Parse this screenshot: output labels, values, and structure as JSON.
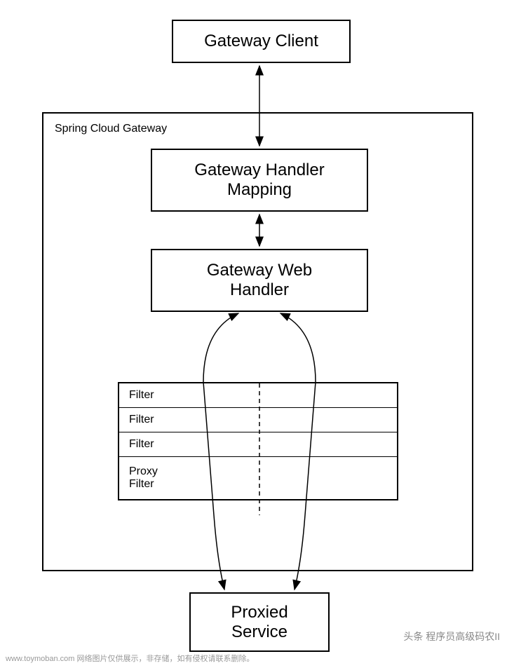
{
  "boxes": {
    "client": "Gateway Client",
    "handler_mapping_line1": "Gateway Handler",
    "handler_mapping_line2": "Mapping",
    "web_handler_line1": "Gateway Web",
    "web_handler_line2": "Handler",
    "proxied_line1": "Proxied",
    "proxied_line2": "Service"
  },
  "container": {
    "label": "Spring Cloud Gateway"
  },
  "filters": {
    "row1": "Filter",
    "row2": "Filter",
    "row3": "Filter",
    "row4_line1": "Proxy",
    "row4_line2": "Filter"
  },
  "watermarks": {
    "bottom": "www.toymoban.com 网络图片仅供展示，非存储，如有侵权请联系删除。",
    "right": "头条 程序员高级码农II"
  }
}
